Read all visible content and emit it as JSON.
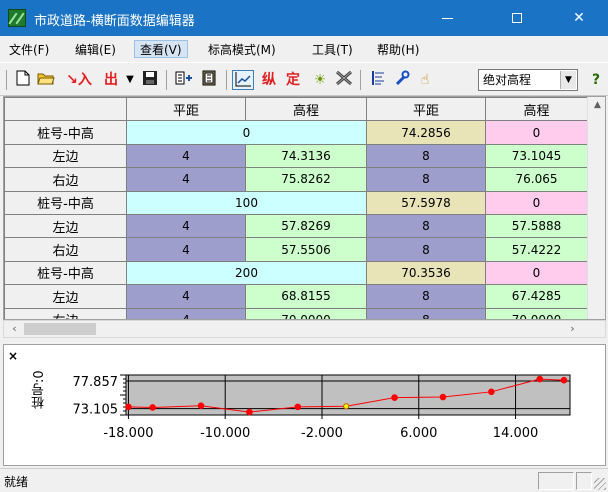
{
  "window": {
    "title": "市政道路-横断面数据编辑器",
    "minimize": "—",
    "maximize": "☐",
    "close": "✕"
  },
  "menu": [
    {
      "label": "文件(F)"
    },
    {
      "label": "编辑(E)"
    },
    {
      "label": "查看(V)"
    },
    {
      "label": "标高模式(M)"
    },
    {
      "label": "工具(T)"
    },
    {
      "label": "帮助(H)"
    }
  ],
  "toolbar": {
    "import_label": "入",
    "export_label": "出",
    "zong_label": "纵",
    "ding_label": "定",
    "combo_value": "绝对高程"
  },
  "grid": {
    "headers": [
      "",
      "平距",
      "高程",
      "平距",
      "高程"
    ],
    "rows": [
      {
        "label": "桩号-中高",
        "type": "center",
        "c1": "0",
        "c2": "74.2856",
        "c3": "0"
      },
      {
        "label": "左边",
        "type": "side",
        "c1": "4",
        "c2": "74.3136",
        "c3": "8",
        "c4": "73.1045"
      },
      {
        "label": "右边",
        "type": "side",
        "c1": "4",
        "c2": "75.8262",
        "c3": "8",
        "c4": "76.065"
      },
      {
        "label": "桩号-中高",
        "type": "center",
        "c1": "100",
        "c2": "57.5978",
        "c3": "0"
      },
      {
        "label": "左边",
        "type": "side",
        "c1": "4",
        "c2": "57.8269",
        "c3": "8",
        "c4": "57.5888"
      },
      {
        "label": "右边",
        "type": "side",
        "c1": "4",
        "c2": "57.5506",
        "c3": "8",
        "c4": "57.4222"
      },
      {
        "label": "桩号-中高",
        "type": "center",
        "c1": "200",
        "c2": "70.3536",
        "c3": "0"
      },
      {
        "label": "左边",
        "type": "side",
        "c1": "4",
        "c2": "68.8155",
        "c3": "8",
        "c4": "67.4285"
      },
      {
        "label": "右边",
        "type": "side",
        "c1": "4",
        "c2": "70.0000",
        "c3": "8",
        "c4": "70.0000"
      }
    ]
  },
  "chart": {
    "close": "×",
    "vertical_label": "桩号:0"
  },
  "chart_data": {
    "type": "line",
    "x": [
      -18,
      -16,
      -12,
      -8,
      -4,
      0,
      4,
      8,
      12,
      16,
      18
    ],
    "y": [
      73.4,
      73.3,
      73.6,
      72.5,
      73.4,
      73.5,
      75.0,
      75.1,
      76.0,
      78.2,
      78.0
    ],
    "highlight_index": 5,
    "xticks": [
      "-18.000",
      "-10.000",
      "-2.000",
      "6.000",
      "14.000"
    ],
    "xtick_values": [
      -18,
      -10,
      -2,
      6,
      14
    ],
    "yticks": [
      "77.857",
      "73.105"
    ],
    "ytick_values": [
      77.857,
      73.105
    ],
    "xlim": [
      -18.2,
      18.5
    ],
    "ylim": [
      72.0,
      78.9
    ],
    "grid": true,
    "line_color": "#ff0000",
    "point_color": "#ff0000",
    "highlight_color": "#ffff00",
    "plot_background": "#c0c0c0"
  },
  "status": {
    "text": "就绪"
  },
  "colors": {
    "titlebar": "#1a73c4",
    "cyan_cell": "#ccffff",
    "khaki_cell": "#e8e4b8",
    "pink_cell": "#ffccee",
    "purple_cell": "#9e9ecd",
    "green_cell": "#ccffcc"
  }
}
